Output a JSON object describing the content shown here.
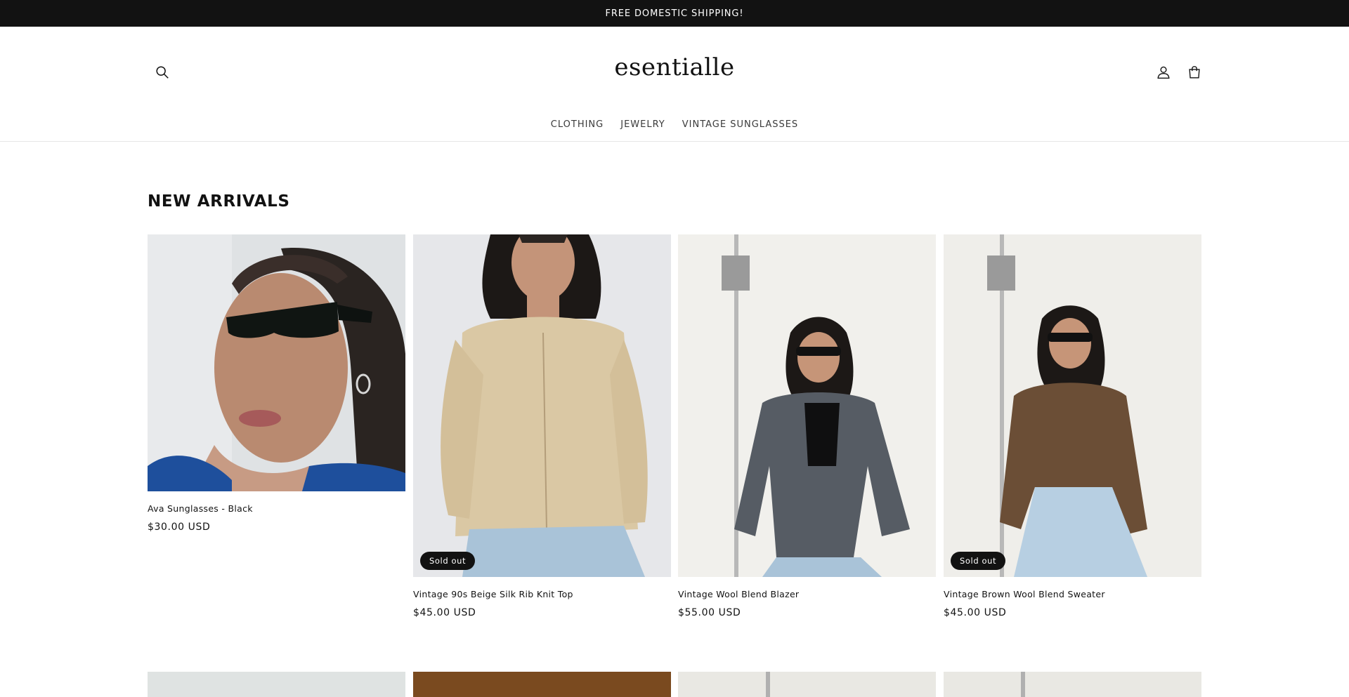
{
  "announcement": {
    "text": "FREE DOMESTIC SHIPPING!"
  },
  "header": {
    "logo": "esentialle",
    "icons": {
      "search": "search-icon",
      "account": "account-icon",
      "cart": "cart-icon"
    },
    "nav": [
      "CLOTHING",
      "JEWELRY",
      "VINTAGE SUNGLASSES"
    ]
  },
  "section": {
    "title": "NEW ARRIVALS"
  },
  "products": [
    {
      "title": "Ava Sunglasses - Black",
      "price": "$30.00 USD",
      "badge": ""
    },
    {
      "title": "Vintage 90s Beige Silk Rib Knit Top",
      "price": "$45.00 USD",
      "badge": "Sold out"
    },
    {
      "title": "Vintage Wool Blend Blazer",
      "price": "$55.00 USD",
      "badge": ""
    },
    {
      "title": "Vintage Brown Wool Blend Sweater",
      "price": "$45.00 USD",
      "badge": "Sold out"
    }
  ],
  "colors": {
    "text": "#121212",
    "announcement_bg": "#121212",
    "background": "#ffffff"
  }
}
